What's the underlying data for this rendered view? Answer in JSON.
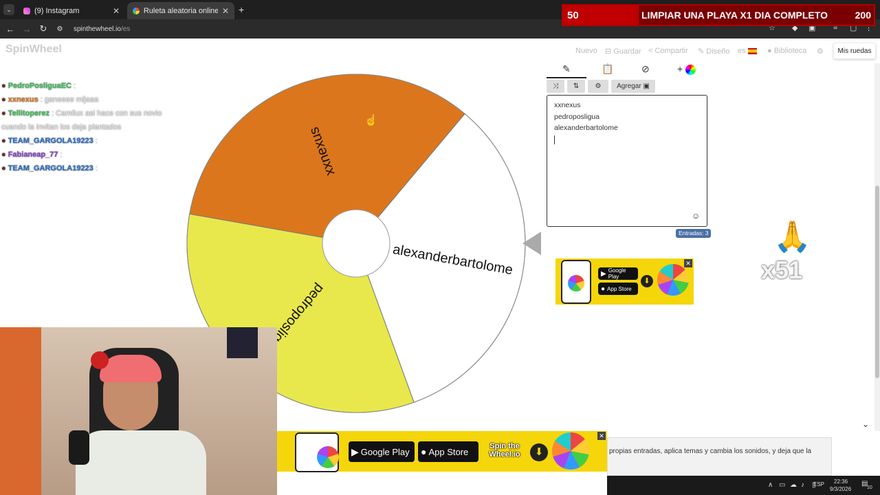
{
  "browser": {
    "tabs": [
      {
        "title": "(9) Instagram",
        "active": false
      },
      {
        "title": "Ruleta aleatoria online – ruleta",
        "active": true
      }
    ],
    "url_domain": "spinthewheel.io",
    "url_path": "/es"
  },
  "stream_banner": {
    "left_number": "50",
    "goal_text": "LIMPIAR UNA PLAYA X1 DIA COMPLETO",
    "right_number": "200"
  },
  "site": {
    "logo": "SpinWheel",
    "nav": [
      "Nuevo",
      "Guardar",
      "Compartir",
      "Diseño",
      "es",
      "Biblioteca"
    ],
    "my_wheels": "Mis ruedas"
  },
  "chat": [
    {
      "user": "PedroPosliguaEC",
      "message": "",
      "user_color": "#3cc05a"
    },
    {
      "user": "xxnexus",
      "message": "ganeeee mijaaa",
      "user_color": "#d97820"
    },
    {
      "user": "Tellitoperez",
      "message": "Camilux asi hace con sus novio cuando la invitan los deja plantados",
      "user_color": "#3cc05a"
    },
    {
      "user": "TEAM_GARGOLA19223",
      "message": "",
      "user_color": "#2a6fc9"
    },
    {
      "user": "Fabianeap_77",
      "message": "",
      "user_color": "#8a3fd1"
    },
    {
      "user": "TEAM_GARGOLA19223",
      "message": "",
      "user_color": "#2a6fc9"
    }
  ],
  "wheel": {
    "segments": [
      {
        "label": "xxnexus",
        "color": "#dc761c"
      },
      {
        "label": "alexanderbartolome",
        "color": "#ffffff"
      },
      {
        "label": "pedroposligua",
        "color": "#e8e84c"
      }
    ]
  },
  "editor": {
    "add_button": "Agregar",
    "entries": [
      "xxnexus",
      "pedroposligua",
      "alexanderbartolome"
    ],
    "entries_count": "Entradas: 3"
  },
  "ads": {
    "google_play": "Google Play",
    "app_store": "App Store",
    "spin_logo": "Spin the Wheel.io"
  },
  "description": "propias entradas, aplica temas y cambia los sonidos, y deja que la",
  "overlay": {
    "multiplier": "x51"
  },
  "taskbar": {
    "lang": "ESP",
    "time": "22:36",
    "date": "9/3/2026",
    "notif": "10"
  }
}
